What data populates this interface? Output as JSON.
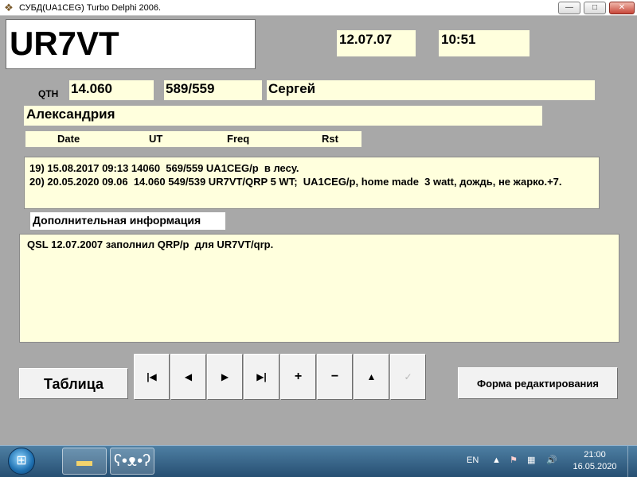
{
  "window": {
    "title": "СУБД(UA1CEG) Turbo Delphi 2006.",
    "controls": {
      "minimize": "—",
      "maximize": "□",
      "close": "✕"
    }
  },
  "header": {
    "callsign": "UR7VT",
    "date": "12.07.07",
    "time": "10:51"
  },
  "station": {
    "qth_label": "QTH",
    "frequency": "14.060",
    "rst": "589/559",
    "name": "Сергей",
    "city": "Александрия"
  },
  "log": {
    "columns": [
      "Date",
      "UT",
      "Freq",
      "Rst"
    ],
    "entries": [
      "19) 15.08.2017 09:13 14060  569/559 UA1CEG/p  в лесу.",
      "20) 20.05.2020 09.06  14.060 549/539 UR7VT/QRP 5 WT;  UA1CEG/p, home made  3 watt, дождь, не жарко.+7."
    ]
  },
  "additional": {
    "label": "Дополнительная информация",
    "text": "QSL 12.07.2007 заполнил QRP/p  для UR7VT/qrp."
  },
  "buttons": {
    "table": "Таблица",
    "edit_form": "Форма редактирования",
    "nav": {
      "first": "|◀",
      "prior": "◀",
      "next": "▶",
      "last": "▶|",
      "insert": "+",
      "delete": "−",
      "edit": "▲",
      "post": "✓"
    }
  },
  "taskbar": {
    "start_icon": "windows-orb-icon",
    "language": "EN",
    "clock_time": "21:00",
    "clock_date": "16.05.2020",
    "tray": {
      "arrow": "▲",
      "flag": "⚑",
      "network": "▦",
      "volume": "🔊"
    }
  },
  "colors": {
    "background": "#a8a8a8",
    "field": "#ffffdd",
    "callsign_bg": "#ffffff",
    "taskbar": "#3a6a91"
  }
}
